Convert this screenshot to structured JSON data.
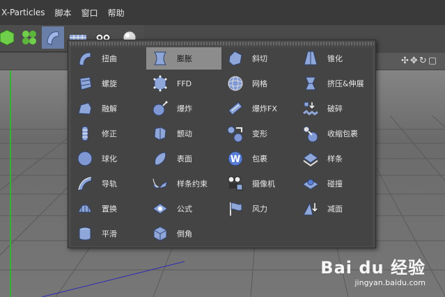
{
  "menubar": {
    "items": [
      "X-Particles",
      "脚本",
      "窗口",
      "帮助"
    ]
  },
  "toolbar": {
    "icons": [
      "object-icon",
      "cloner-icon",
      "deformer-icon",
      "grid-icon",
      "camera-icon",
      "light-icon"
    ],
    "active": 2
  },
  "viewport": {
    "nav_icons": "✣✥↻▢"
  },
  "deformer_menu": {
    "columns": [
      {
        "items": [
          {
            "label": "扭曲",
            "icon": "bend-icon"
          },
          {
            "label": "螺旋",
            "icon": "twist-icon"
          },
          {
            "label": "融解",
            "icon": "melt-icon"
          },
          {
            "label": "修正",
            "icon": "correction-icon"
          },
          {
            "label": "球化",
            "icon": "spherify-icon"
          },
          {
            "label": "导轨",
            "icon": "rail-icon"
          },
          {
            "label": "置换",
            "icon": "displacer-icon"
          },
          {
            "label": "平滑",
            "icon": "smoothing-icon"
          }
        ]
      },
      {
        "items": [
          {
            "label": "膨胀",
            "icon": "bulge-icon",
            "highlighted": true
          },
          {
            "label": "FFD",
            "icon": "ffd-icon"
          },
          {
            "label": "爆炸",
            "icon": "explosion-icon"
          },
          {
            "label": "颤动",
            "icon": "jiggle-icon"
          },
          {
            "label": "表面",
            "icon": "surface-icon"
          },
          {
            "label": "样条约束",
            "icon": "spline-wrap-icon"
          },
          {
            "label": "公式",
            "icon": "formula-icon"
          },
          {
            "label": "倒角",
            "icon": "bevel-icon"
          }
        ]
      },
      {
        "items": [
          {
            "label": "斜切",
            "icon": "shear-icon"
          },
          {
            "label": "网格",
            "icon": "mesh-icon"
          },
          {
            "label": "爆炸FX",
            "icon": "explosion-fx-icon"
          },
          {
            "label": "变形",
            "icon": "morph-icon"
          },
          {
            "label": "包裹",
            "icon": "wrap-icon"
          },
          {
            "label": "摄像机",
            "icon": "camera-deformer-icon"
          },
          {
            "label": "风力",
            "icon": "wind-icon"
          }
        ]
      },
      {
        "items": [
          {
            "label": "锥化",
            "icon": "taper-icon"
          },
          {
            "label": "挤压&伸展",
            "icon": "squash-stretch-icon"
          },
          {
            "label": "破碎",
            "icon": "shatter-icon"
          },
          {
            "label": "收缩包裹",
            "icon": "shrink-wrap-icon"
          },
          {
            "label": "样条",
            "icon": "spline-icon"
          },
          {
            "label": "碰撞",
            "icon": "collision-icon"
          },
          {
            "label": "减面",
            "icon": "polygon-reduction-icon"
          }
        ]
      }
    ]
  },
  "watermark": {
    "brand": "Bai du 经验",
    "url": "jingyan.baidu.com"
  },
  "colors": {
    "accent": "#6a7fa8",
    "highlight": "#8c8c8c",
    "menu_bg": "#444444",
    "icon_blue": "#8ea6d8"
  }
}
